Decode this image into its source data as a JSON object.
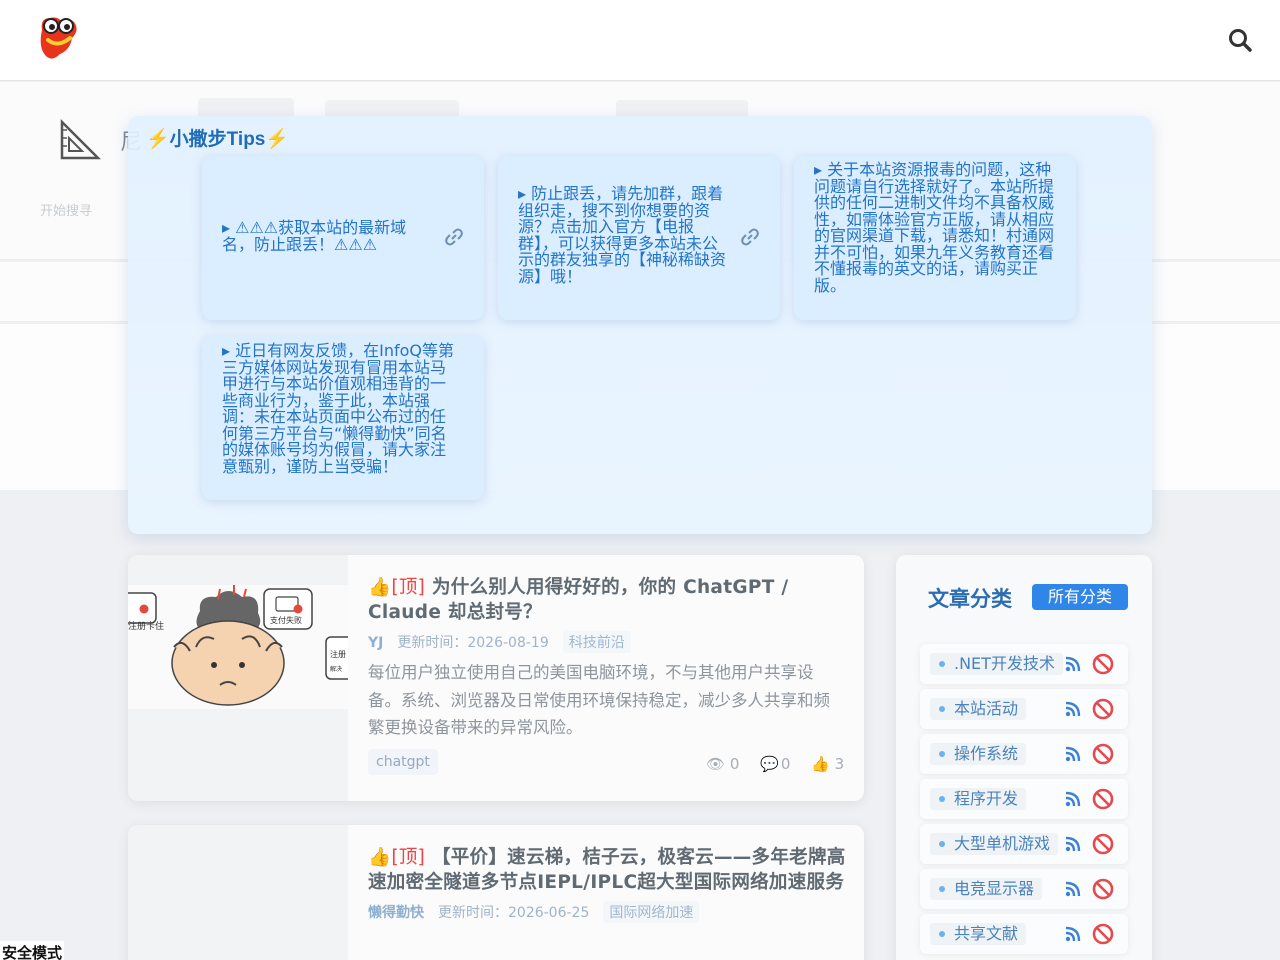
{
  "header": {
    "logo_icon": "mascot-logo-icon",
    "search_icon": "search-icon"
  },
  "background": {
    "muted_label": "开始搜寻",
    "muted_char": "尼"
  },
  "tips": {
    "title": "⚡小撒步Tips⚡",
    "items": [
      {
        "text": "▸ ⚠⚠⚠获取本站的最新域名，防止跟丢！⚠⚠⚠",
        "icon": "link-icon"
      },
      {
        "text": "▸ 防止跟丢，请先加群，跟着组织走，搜不到你想要的资源？点击加入官方【电报群】，可以获得更多本站未公示的群友独享的【神秘稀缺资源】哦！",
        "icon": "link-icon"
      },
      {
        "text": "▸ 关于本站资源报毒的问题，这种问题请自行选择就好了。本站所提供的任何二进制文件均不具备权威性，如需体验官方正版，请从相应的官网渠道下载，请悉知！村通网并不可怕，如果九年义务教育还看不懂报毒的英文的话，请购买正版。"
      },
      {
        "text": "▸ 近日有网友反馈，在InfoQ等第三方媒体网站发现有冒用本站马甲进行与本站价值观相违背的一些商业行为，鉴于此，本站强调：未在本站页面中公布过的任何第三方平台与“懒得勤快”同名的媒体账号均为假冒，请大家注意甄别，谨防上当受骗！"
      }
    ]
  },
  "articles": [
    {
      "top_label": "[顶]",
      "title": "为什么别人用得好好的，你的 ChatGPT / Claude 却总封号？",
      "author": "YJ",
      "updated_label": "更新时间：",
      "updated": "2026-08-19",
      "category": "科技前沿",
      "excerpt": "每位用户独立使用自己的美国电脑环境，不与其他用户共享设备。系统、浏览器及日常使用环境保持稳定，减少多人共享和频繁更换设备带来的异常风险。",
      "tag": "chatgpt",
      "views": "0",
      "comments": "0",
      "likes": "3",
      "thumb_labels": [
        "注册卡住",
        "支付失败",
        "注册",
        "解决"
      ]
    },
    {
      "top_label": "[顶]",
      "title": "【平价】速云梯，桔子云，极客云——多年老牌高速加密全隧道多节点IEPL/IPLC超大型国际网络加速服务",
      "author": "懒得勤快",
      "updated_label": "更新时间：",
      "updated": "2026-06-25",
      "category": "国际网络加速"
    }
  ],
  "sidebar": {
    "title": "文章分类",
    "all_button": "所有分类",
    "categories": [
      {
        "label": ".NET开发技术"
      },
      {
        "label": "本站活动"
      },
      {
        "label": "操作系统"
      },
      {
        "label": "程序开发"
      },
      {
        "label": "大型单机游戏"
      },
      {
        "label": "电竞显示器"
      },
      {
        "label": "共享文献"
      }
    ]
  },
  "footer": {
    "safe_mode": "安全模式"
  },
  "colors": {
    "accent": "#2f86e8",
    "tips_text": "#2374c6",
    "top_tag": "#ef4444",
    "rss": "#3b82d6",
    "ban": "#e5484d"
  }
}
